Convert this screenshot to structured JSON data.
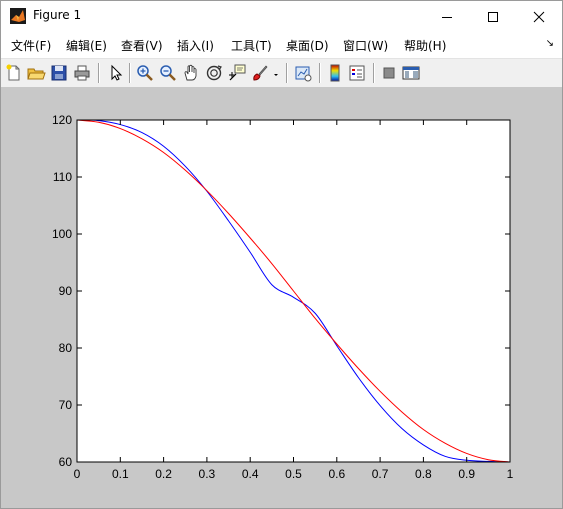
{
  "window": {
    "title": "Figure 1",
    "controls": {
      "minimize": "minimize",
      "maximize": "maximize",
      "close": "close"
    }
  },
  "menu": {
    "items": [
      "文件(F)",
      "编辑(E)",
      "查看(V)",
      "插入(I)",
      "工具(T)",
      "桌面(D)",
      "窗口(W)",
      "帮助(H)"
    ],
    "dock_arrow": "↘"
  },
  "toolbar": {
    "icons": [
      "new-figure-icon",
      "open-file-icon",
      "save-icon",
      "print-icon",
      "pointer-icon",
      "zoom-in-icon",
      "zoom-out-icon",
      "pan-hand-icon",
      "rotate-3d-icon",
      "data-cursor-icon",
      "brush-icon",
      "brush-dropdown-icon",
      "link-plot-icon",
      "colorbar-icon",
      "legend-icon",
      "hide-plot-tools-icon",
      "show-plot-tools-icon"
    ]
  },
  "colors": {
    "canvas": "#c8c8c8",
    "series_blue": "#0000ff",
    "series_red": "#ff0000"
  },
  "chart_data": {
    "type": "line",
    "title": "",
    "xlabel": "",
    "ylabel": "",
    "xlim": [
      0,
      1
    ],
    "ylim": [
      60,
      120
    ],
    "xticks": [
      "0",
      "0.1",
      "0.2",
      "0.3",
      "0.4",
      "0.5",
      "0.6",
      "0.7",
      "0.8",
      "0.9",
      "1"
    ],
    "yticks": [
      "60",
      "70",
      "80",
      "90",
      "100",
      "110",
      "120"
    ],
    "grid": false,
    "series": [
      {
        "color": "#0000ff",
        "x": [
          0,
          0.05,
          0.1,
          0.15,
          0.2,
          0.25,
          0.3,
          0.35,
          0.4,
          0.45,
          0.5,
          0.55,
          0.6,
          0.65,
          0.7,
          0.75,
          0.8,
          0.85,
          0.9,
          0.95,
          1
        ],
        "y": [
          120,
          119.9,
          119.2,
          117.8,
          115.4,
          111.9,
          107.5,
          102.3,
          96.8,
          91.1,
          88.9,
          86.1,
          80.4,
          74.8,
          69.9,
          65.9,
          63.0,
          61.0,
          60.3,
          60.1,
          60
        ]
      },
      {
        "color": "#ff0000",
        "x": [
          0,
          0.05,
          0.1,
          0.15,
          0.2,
          0.25,
          0.3,
          0.35,
          0.4,
          0.45,
          0.5,
          0.55,
          0.6,
          0.65,
          0.7,
          0.75,
          0.8,
          0.85,
          0.9,
          0.95,
          1
        ],
        "y": [
          120,
          119.6,
          118.5,
          116.7,
          114.3,
          111.2,
          107.6,
          103.6,
          99.3,
          94.8,
          90.0,
          85.2,
          80.7,
          76.4,
          72.4,
          68.8,
          65.7,
          63.3,
          61.5,
          60.4,
          60
        ]
      }
    ]
  }
}
